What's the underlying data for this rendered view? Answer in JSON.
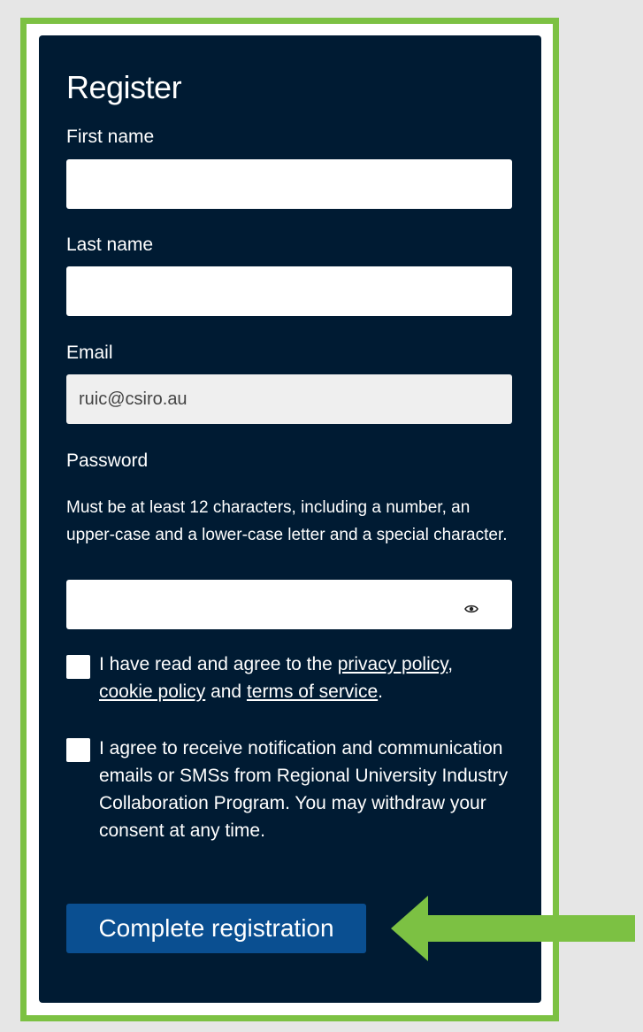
{
  "form": {
    "title": "Register",
    "first_name_label": "First name",
    "first_name_value": "",
    "last_name_label": "Last name",
    "last_name_value": "",
    "email_label": "Email",
    "email_value": "ruic@csiro.au",
    "password_label": "Password",
    "password_hint": "Must be at least 12 characters, including a number, an upper-case and a lower-case letter and a special character.",
    "password_value": "",
    "show_password_icon": "eye-icon",
    "consent_terms": {
      "prefix": "I have read and agree to the ",
      "privacy_link": "privacy policy",
      "sep1": ",",
      "cookie_link": "cookie policy",
      "and": " and ",
      "terms_link": "terms of service",
      "suffix": ".",
      "checked": false
    },
    "consent_comms": {
      "text": "I agree to receive notification and communication emails or SMSs from Regional University Industry Collaboration Program. You may withdraw your consent at any time.",
      "checked": false
    },
    "submit_label": "Complete registration"
  },
  "annotation": {
    "highlight_color": "#7cc143",
    "arrow_icon": "left-arrow-icon"
  },
  "colors": {
    "panel": "#001b33",
    "button": "#0a4f91"
  }
}
